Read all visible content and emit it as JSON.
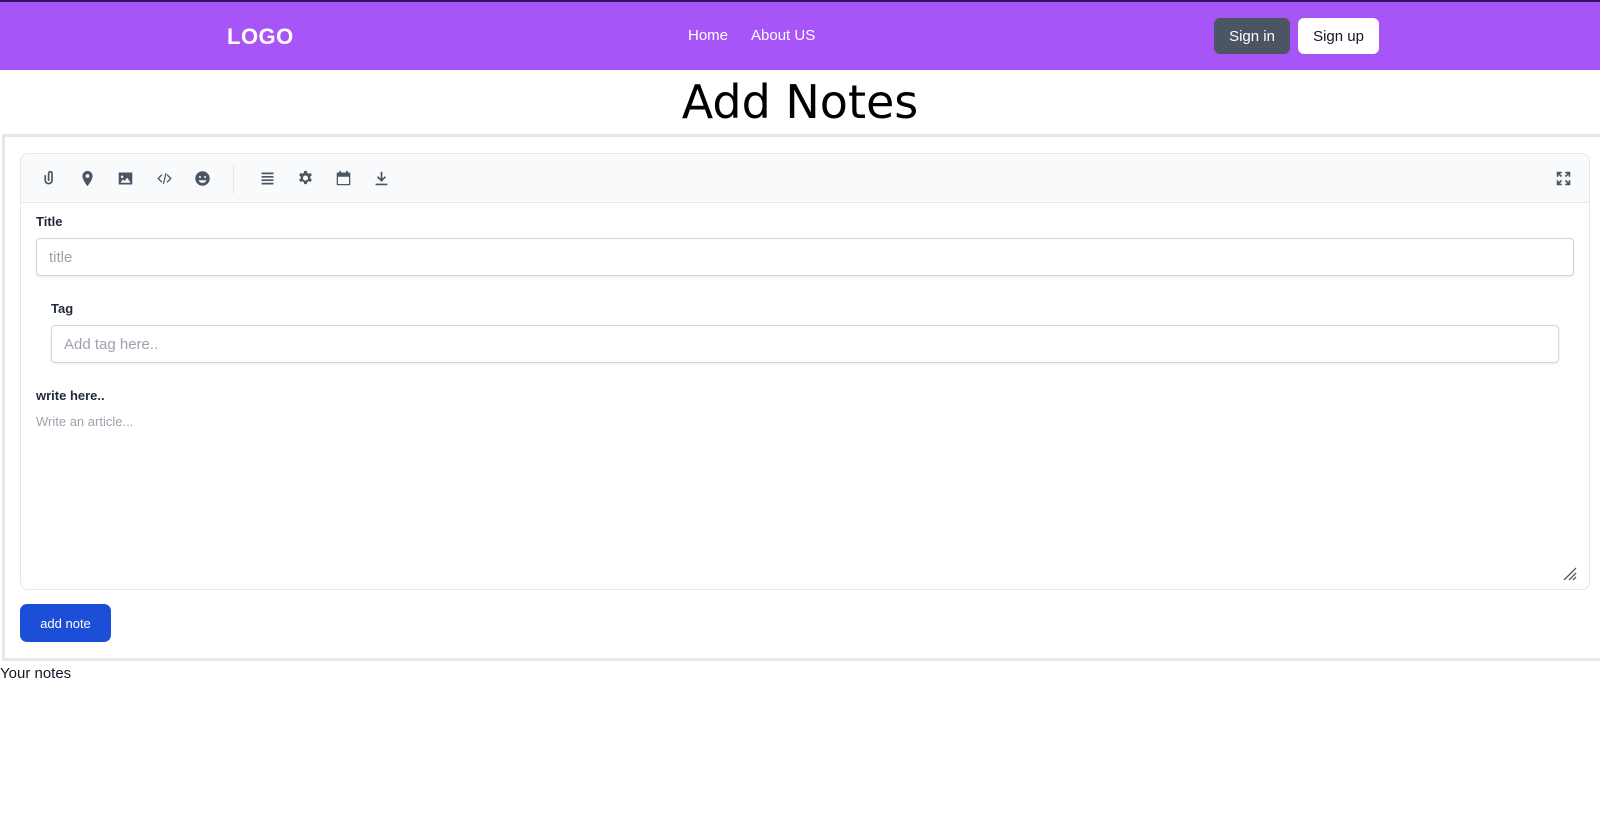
{
  "navbar": {
    "logo": "LOGO",
    "links": [
      "Home",
      "About US"
    ],
    "signin_label": "Sign in",
    "signup_label": "Sign up",
    "bg_color": "#a855f7"
  },
  "page": {
    "title": "Add Notes",
    "your_notes": "Your notes"
  },
  "toolbar": {
    "left_tools": [
      "paperclip-icon",
      "map-pin-icon",
      "image-icon",
      "code-icon",
      "emoji-icon"
    ],
    "right_tools": [
      "list-icon",
      "gear-icon",
      "calendar-icon",
      "download-icon"
    ],
    "fullscreen": "expand-icon"
  },
  "form": {
    "title_label": "Title",
    "title_placeholder": "title",
    "tag_label": "Tag",
    "tag_placeholder": "Add tag here..",
    "body_label": "write here..",
    "body_placeholder": "Write an article...",
    "submit_label": "add note",
    "submit_color": "#1d4ed8"
  }
}
